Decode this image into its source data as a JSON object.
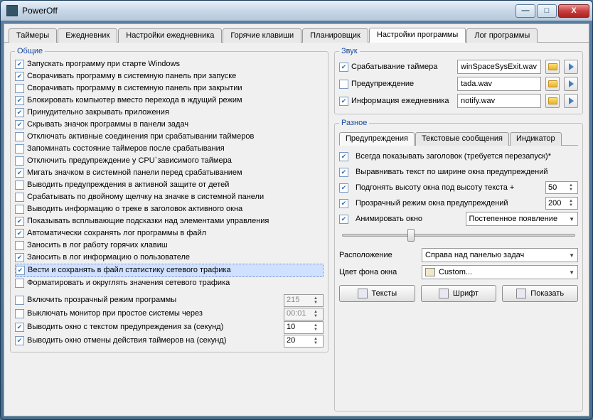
{
  "window": {
    "title": "PowerOff"
  },
  "tabs": [
    "Таймеры",
    "Ежедневник",
    "Настройки ежедневника",
    "Горячие клавиши",
    "Планировщик",
    "Настройки программы",
    "Лог программы"
  ],
  "active_tab": 5,
  "group_general": "Общие",
  "general_items": [
    {
      "c": true,
      "t": "Запускать программу при старте Windows"
    },
    {
      "c": true,
      "t": "Сворачивать программу в системную панель при запуске"
    },
    {
      "c": false,
      "t": "Сворачивать программу в системную панель при закрытии"
    },
    {
      "c": true,
      "t": "Блокировать компьютер вместо перехода в ждущий режим"
    },
    {
      "c": true,
      "t": "Принудительно закрывать приложения"
    },
    {
      "c": true,
      "t": "Скрывать значок программы в панели задач"
    },
    {
      "c": false,
      "t": "Отключать активные соединения при срабатывании таймеров"
    },
    {
      "c": false,
      "t": "Запоминать состояние таймеров после срабатывания"
    },
    {
      "c": false,
      "t": "Отключить предупреждение у CPU`зависимого таймера"
    },
    {
      "c": true,
      "t": "Мигать значком в системной панели перед срабатыванием"
    },
    {
      "c": false,
      "t": "Выводить предупреждения в активной защите от детей"
    },
    {
      "c": false,
      "t": "Срабатывать по двойному щелчку на значке в системной панели"
    },
    {
      "c": false,
      "t": "Выводить информацию о треке в заголовок активного окна"
    },
    {
      "c": true,
      "t": "Показывать всплывающие подсказки над элементами управления"
    },
    {
      "c": true,
      "t": "Автоматически сохранять лог программы в файл"
    },
    {
      "c": false,
      "t": "Заносить в лог работу горячих клавиш"
    },
    {
      "c": true,
      "t": "Заносить в лог информацию о пользователе"
    },
    {
      "c": true,
      "t": "Вести и сохранять в файл статистику сетевого трафика",
      "sel": true
    },
    {
      "c": false,
      "t": "Форматировать и округлять значения сетевого трафика"
    }
  ],
  "extra_rows": [
    {
      "c": false,
      "t": "Включить прозрачный режим программы",
      "v": "215",
      "vdisabled": true
    },
    {
      "c": false,
      "t": "Выключать монитор при простое системы через",
      "v": "00:01",
      "vdisabled": true
    },
    {
      "c": true,
      "t": "Выводить окно с текстом предупреждения за (секунд)",
      "v": "10"
    },
    {
      "c": true,
      "t": "Выводить окно отмены действия таймеров на (секунд)",
      "v": "20"
    }
  ],
  "group_sound": "Звук",
  "sounds": [
    {
      "c": true,
      "t": "Срабатывание таймера",
      "file": "winSpaceSysExit.wav"
    },
    {
      "c": false,
      "t": "Предупреждение",
      "file": "tada.wav"
    },
    {
      "c": true,
      "t": "Информация ежедневника",
      "file": "notify.wav"
    }
  ],
  "group_misc": "Разное",
  "misc_tabs": [
    "Предупреждения",
    "Текстовые сообщения",
    "Индикатор"
  ],
  "misc_active": 0,
  "warnings": {
    "items": [
      {
        "c": true,
        "t": "Всегда показывать заголовок (требуется перезапуск)*"
      },
      {
        "c": true,
        "t": "Выравнивать текст по ширине окна предупреждений"
      },
      {
        "c": true,
        "t": "Подгонять высоту окна под высоту текста  +",
        "v": "50"
      },
      {
        "c": true,
        "t": "Прозрачный режим окна предупреждений",
        "v": "200"
      },
      {
        "c": true,
        "t": "Анимировать окно"
      }
    ],
    "anim_mode": "Постепенное появление",
    "pos_label": "Расположение",
    "pos_value": "Справа над панелью задач",
    "bg_label": "Цвет фона окна",
    "bg_value": "Custom...",
    "btn_texts": "Тексты",
    "btn_font": "Шрифт",
    "btn_show": "Показать"
  }
}
